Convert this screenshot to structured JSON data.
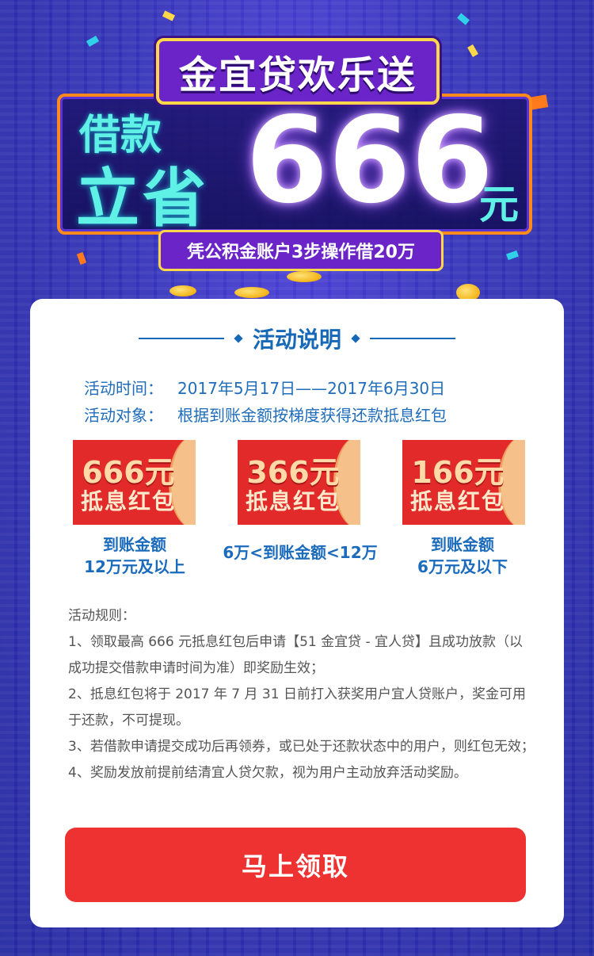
{
  "hero": {
    "title": "金宜贷欢乐送",
    "jiekuan": "借款",
    "lisheng": "立省",
    "amount": "666",
    "unit": "元",
    "subtitle": "凭公积金账户3步操作借20万"
  },
  "section": {
    "title": "活动说明"
  },
  "info": {
    "time_label": "活动时间：",
    "time_value": "2017年5月17日——2017年6月30日",
    "target_label": "活动对象：",
    "target_value": "根据到账金额按梯度获得还款抵息红包"
  },
  "coupons": [
    {
      "amount": "666元",
      "name": "抵息红包",
      "cap_line1": "到账金额",
      "cap_line2": "12万元及以上"
    },
    {
      "amount": "366元",
      "name": "抵息红包",
      "cap_line1": "6万<到账金额<12万",
      "cap_line2": ""
    },
    {
      "amount": "166元",
      "name": "抵息红包",
      "cap_line1": "到账金额",
      "cap_line2": "6万元及以下"
    }
  ],
  "rules": {
    "heading": "活动规则：",
    "items": [
      "1、领取最高 666 元抵息红包后申请【51 金宜贷 - 宜人贷】且成功放款（以成功提交借款申请时间为准）即奖励生效；",
      "2、抵息红包将于 2017 年 7 月 31 日前打入获奖用户宜人贷账户，奖金可用于还款，不可提现。",
      "3、若借款申请提交成功后再领券，或已处于还款状态中的用户，则红包无效；",
      "4、奖励发放前提前结清宜人贷欠款，视为用户主动放弃活动奖励。"
    ]
  },
  "cta": {
    "label": "马上领取"
  },
  "colors": {
    "brand_blue": "#1769b8",
    "cta_red": "#ee3232",
    "coupon_red": "#e22a2a",
    "accent_yellow": "#ffd84a"
  }
}
